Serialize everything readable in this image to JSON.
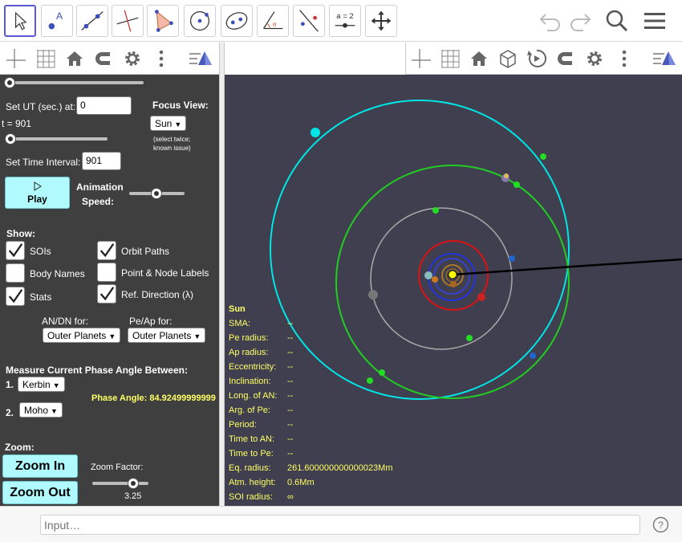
{
  "colors": {
    "panel_bg": "#3f3f40",
    "graphics_bg": "#3f3f4f",
    "accent": "#5a5ad6",
    "highlight_yellow": "#ffff66",
    "button_cyan": "#b0fafd"
  },
  "toolbar": {
    "tools": [
      {
        "name": "move-tool-icon",
        "selected": true
      },
      {
        "name": "point-tool-icon"
      },
      {
        "name": "line-tool-icon"
      },
      {
        "name": "perpendicular-line-tool-icon"
      },
      {
        "name": "polygon-tool-icon"
      },
      {
        "name": "circle-tool-icon"
      },
      {
        "name": "ellipse-tool-icon"
      },
      {
        "name": "angle-tool-icon"
      },
      {
        "name": "reflect-tool-icon"
      },
      {
        "name": "slider-tool-icon",
        "label": "a = 2"
      },
      {
        "name": "move-graphics-tool-icon"
      }
    ],
    "actions": [
      "undo-icon",
      "redo-icon",
      "search-icon",
      "menu-icon"
    ]
  },
  "left_panel": {
    "set_ut_label": "Set UT (sec.) at:",
    "set_ut_value": "0",
    "t_display": "t = 901",
    "set_interval_label": "Set Time Interval:",
    "set_interval_value": "901",
    "focus_view_label": "Focus View:",
    "focus_view_value": "Sun",
    "focus_note_1": "(select twice;",
    "focus_note_2": "known issue)",
    "play_label": "Play",
    "animation_label_1": "Animation",
    "animation_label_2": "Speed:",
    "show_label": "Show:",
    "checkboxes": [
      {
        "label": "SOIs",
        "checked": true
      },
      {
        "label": "Orbit Paths",
        "checked": true
      },
      {
        "label": "Body Names",
        "checked": false
      },
      {
        "label": "Point & Node Labels",
        "checked": false
      },
      {
        "label": "Stats",
        "checked": true
      },
      {
        "label": "Ref. Direction (λ)",
        "checked": true
      }
    ],
    "an_dn_label": "AN/DN for:",
    "an_dn_value": "Outer Planets",
    "pe_ap_label": "Pe/Ap for:",
    "pe_ap_value": "Outer Planets",
    "phase_header": "Measure Current Phase Angle Between:",
    "phase_1_label": "1.",
    "phase_1_value": "Kerbin",
    "phase_2_label": "2.",
    "phase_2_value": "Moho",
    "phase_angle_text": "Phase Angle: 84.92499999999",
    "zoom_label": "Zoom:",
    "zoom_in_label": "Zoom In",
    "zoom_out_label": "Zoom Out",
    "zoom_factor_label": "Zoom Factor:",
    "zoom_factor_value": "3.25"
  },
  "stats": {
    "body": "Sun",
    "rows": [
      {
        "label": "SMA:",
        "value": "--"
      },
      {
        "label": "Pe radius:",
        "value": "--"
      },
      {
        "label": "Ap radius:",
        "value": "--"
      },
      {
        "label": "Eccentricity:",
        "value": "--"
      },
      {
        "label": "Inclination:",
        "value": "--"
      },
      {
        "label": "Long. of AN:",
        "value": "--"
      },
      {
        "label": "Arg. of Pe:",
        "value": "--"
      },
      {
        "label": "Period:",
        "value": "--"
      },
      {
        "label": "Time to AN:",
        "value": "--"
      },
      {
        "label": "Time to Pe:",
        "value": "--"
      },
      {
        "label": "Eq. radius:",
        "value": "261.600000000000023Mm"
      },
      {
        "label": "Atm. height:",
        "value": "0.6Mm"
      },
      {
        "label": "SOI radius:",
        "value": "∞"
      }
    ]
  },
  "input_bar": {
    "placeholder": "Input…"
  }
}
